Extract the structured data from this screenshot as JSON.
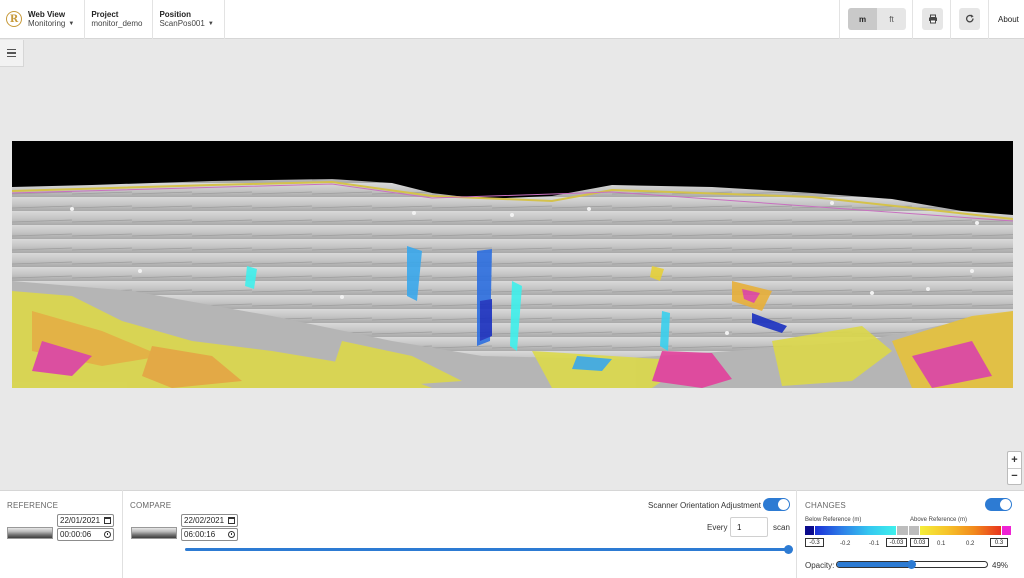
{
  "header": {
    "logo_letter": "R",
    "webview": {
      "title": "Web View",
      "value": "Monitoring"
    },
    "project": {
      "title": "Project",
      "value": "monitor_demo"
    },
    "position": {
      "title": "Position",
      "value": "ScanPos001"
    },
    "units": [
      "m",
      "ft"
    ],
    "active_unit": "m",
    "about": "About"
  },
  "reference": {
    "title": "REFERENCE",
    "date": "22/01/2021",
    "time": "00:00:06"
  },
  "compare": {
    "title": "COMPARE",
    "date": "22/02/2021",
    "time": "06:00:16",
    "orientation_label": "Scanner Orientation Adjustment",
    "orientation_on": true,
    "every_label": "Every",
    "every_value": "1",
    "scan_label": "scan",
    "timeline_position": 1.0
  },
  "changes": {
    "title": "CHANGES",
    "enabled": true,
    "below_label": "Below Reference (m)",
    "above_label": "Above Reference (m)",
    "below_ticks": [
      "-0.3",
      "-0.2",
      "-0.1",
      "-0.03"
    ],
    "above_ticks": [
      "0.03",
      "0.1",
      "0.2",
      "0.3"
    ],
    "opacity_label": "Opacity:",
    "opacity_value": "49%",
    "opacity_fraction": 0.49,
    "colors": {
      "below_min": "#0a0a8c",
      "below_grad": [
        "#1a2fd6",
        "#2e7fe8",
        "#35c7f0",
        "#3ff0ec"
      ],
      "neutral": "#bdbdbd",
      "above_grad": [
        "#f5ee3a",
        "#f6c42a",
        "#f28a1c",
        "#e8351e"
      ],
      "above_max": "#ee22d4"
    }
  },
  "zoom": {
    "plus": "+",
    "minus": "−"
  }
}
